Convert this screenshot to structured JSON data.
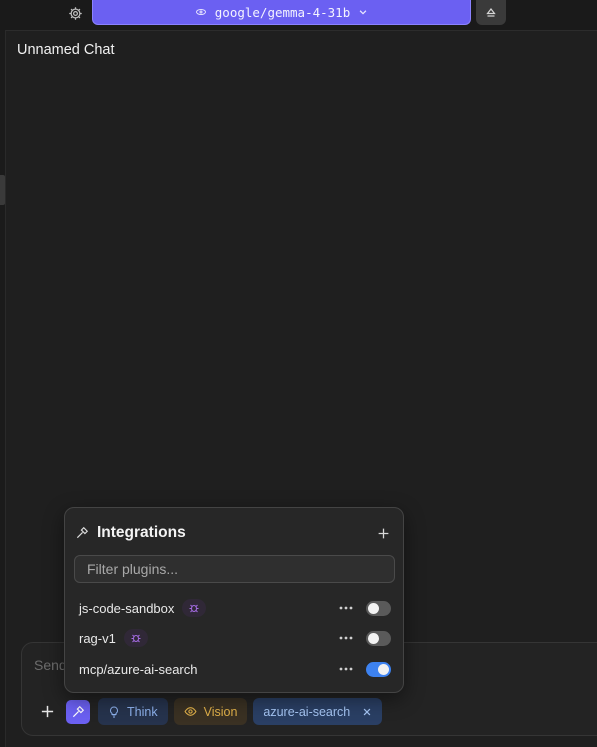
{
  "model": {
    "label": "google/gemma-4-31b",
    "icon": "model-icon",
    "accent": "#6b60f2"
  },
  "chat": {
    "title": "Unnamed Chat"
  },
  "composer": {
    "placeholder": "Send",
    "chips": {
      "think": "Think",
      "vision": "Vision",
      "integration": "azure-ai-search"
    }
  },
  "integrations": {
    "title": "Integrations",
    "filter_placeholder": "Filter plugins...",
    "plugins": [
      {
        "name": "js-code-sandbox",
        "badge": "bug-icon",
        "enabled": false
      },
      {
        "name": "rag-v1",
        "badge": "bug-icon",
        "enabled": false
      },
      {
        "name": "mcp/azure-ai-search",
        "enabled": true
      }
    ]
  },
  "colors": {
    "toggle_on": "#3d82f0",
    "toggle_off": "#5a5a5a",
    "think_chip": "#8fb3ef",
    "vision_chip": "#e2b24a"
  }
}
